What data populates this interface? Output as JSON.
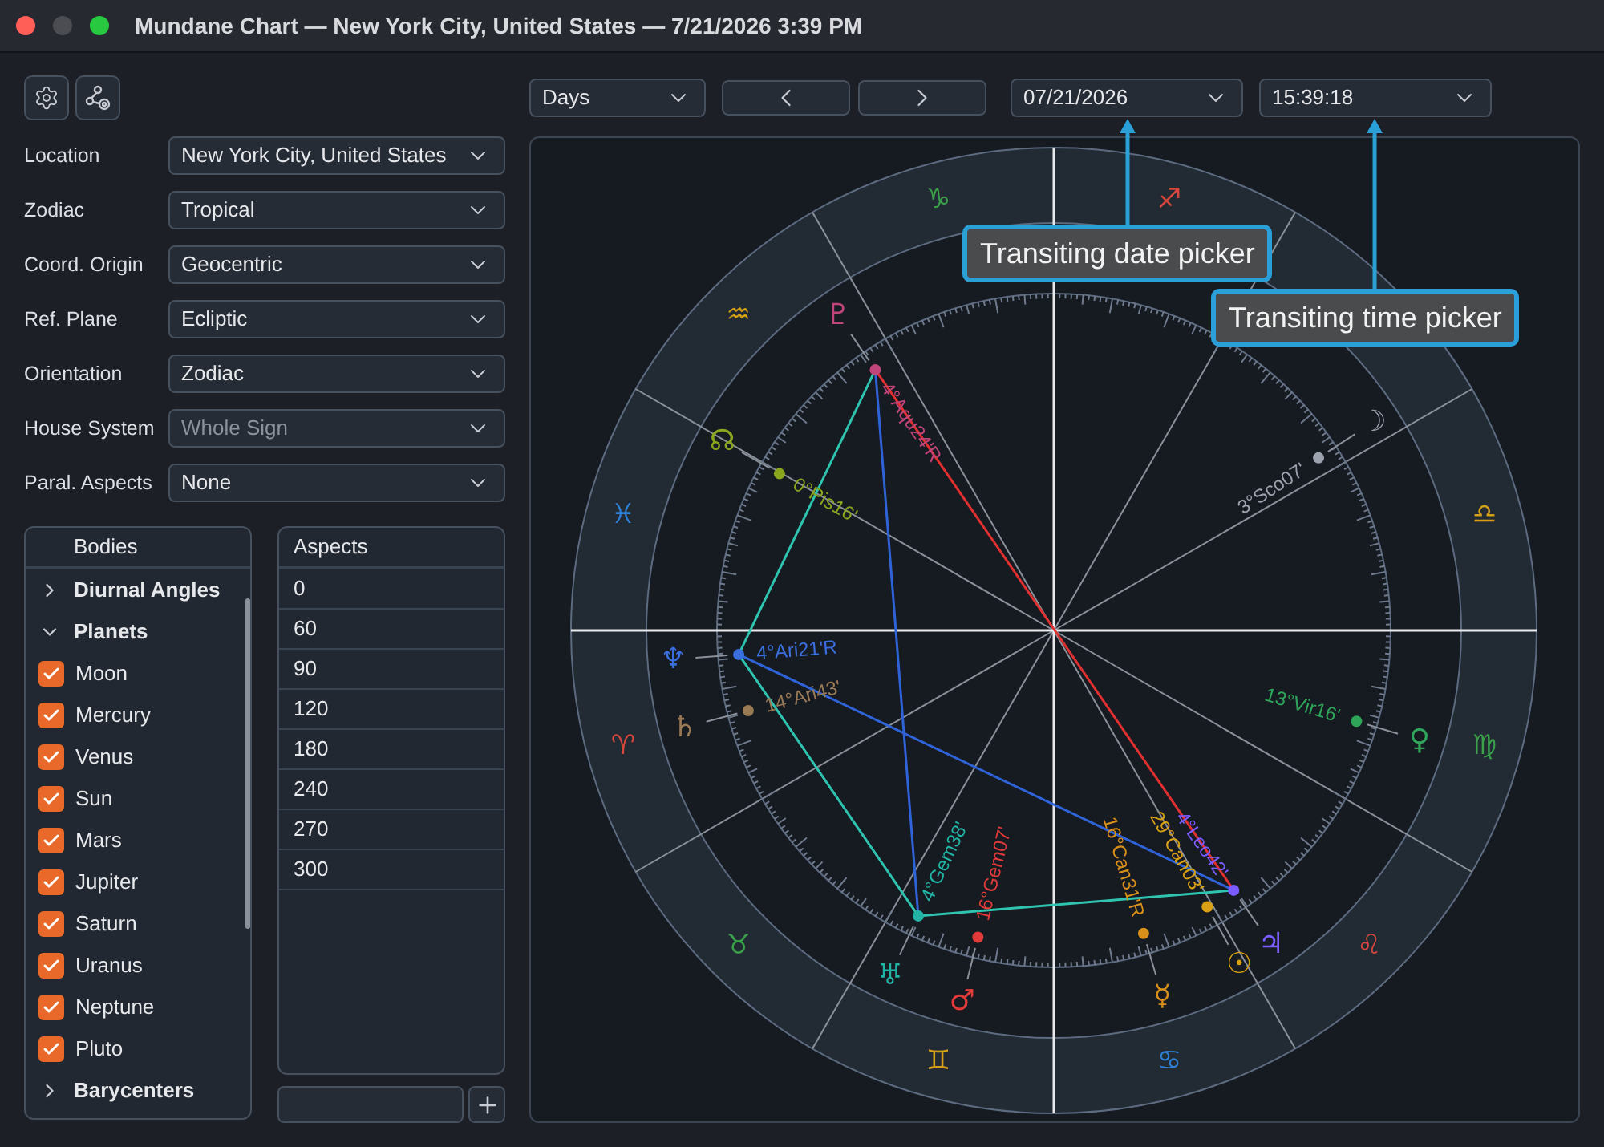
{
  "window": {
    "title": "Mundane Chart — New York City, United States — 7/21/2026 3:39 PM"
  },
  "toolbar": {
    "period": "Days",
    "date": "07/21/2026",
    "time": "15:39:18"
  },
  "callouts": [
    {
      "text": "Transiting date picker"
    },
    {
      "text": "Transiting time picker"
    }
  ],
  "settings": [
    {
      "label": "Location",
      "value": "New York City, United States",
      "disabled": false
    },
    {
      "label": "Zodiac",
      "value": "Tropical",
      "disabled": false
    },
    {
      "label": "Coord. Origin",
      "value": "Geocentric",
      "disabled": false
    },
    {
      "label": "Ref. Plane",
      "value": "Ecliptic",
      "disabled": false
    },
    {
      "label": "Orientation",
      "value": "Zodiac",
      "disabled": false
    },
    {
      "label": "House System",
      "value": "Whole Sign",
      "disabled": true
    },
    {
      "label": "Paral. Aspects",
      "value": "None",
      "disabled": false
    }
  ],
  "bodies": {
    "title": "Bodies",
    "groups": [
      {
        "label": "Diurnal Angles",
        "expanded": false
      },
      {
        "label": "Planets",
        "expanded": true,
        "children": [
          {
            "label": "Moon",
            "checked": true
          },
          {
            "label": "Mercury",
            "checked": true
          },
          {
            "label": "Venus",
            "checked": true
          },
          {
            "label": "Sun",
            "checked": true
          },
          {
            "label": "Mars",
            "checked": true
          },
          {
            "label": "Jupiter",
            "checked": true
          },
          {
            "label": "Saturn",
            "checked": true
          },
          {
            "label": "Uranus",
            "checked": true
          },
          {
            "label": "Neptune",
            "checked": true
          },
          {
            "label": "Pluto",
            "checked": true
          }
        ]
      },
      {
        "label": "Barycenters",
        "expanded": false
      }
    ]
  },
  "aspects": {
    "title": "Aspects",
    "items": [
      "0",
      "60",
      "90",
      "120",
      "180",
      "240",
      "270",
      "300"
    ]
  },
  "chart": {
    "signs": [
      {
        "glyph": "♈",
        "color": "#d9463b"
      },
      {
        "glyph": "♉",
        "color": "#3aa04a"
      },
      {
        "glyph": "♊",
        "color": "#d4a017"
      },
      {
        "glyph": "♋",
        "color": "#2e7fd6"
      },
      {
        "glyph": "♌",
        "color": "#d9463b"
      },
      {
        "glyph": "♍",
        "color": "#3aa04a"
      },
      {
        "glyph": "♎",
        "color": "#d4a017"
      },
      {
        "glyph": "♐",
        "color": "#d9463b"
      },
      {
        "glyph": "♑",
        "color": "#3aa04a"
      },
      {
        "glyph": "♒",
        "color": "#d4a017"
      },
      {
        "glyph": "♓",
        "color": "#2e7fd6"
      }
    ],
    "planets": [
      {
        "glyph": "☽",
        "label": "3°Sco07'",
        "color": "#9ca3af"
      },
      {
        "glyph": "☿",
        "label": "16°Can31'R",
        "color": "#d9901a"
      },
      {
        "glyph": "♀",
        "label": "13°Vir16'",
        "color": "#2fa55a"
      },
      {
        "glyph": "☉",
        "label": "29°Can03'",
        "color": "#d9a015"
      },
      {
        "glyph": "♂",
        "label": "16°Gem07'",
        "color": "#e03a3a"
      },
      {
        "glyph": "♃",
        "label": "4°Leo42'",
        "color": "#7b5cff"
      },
      {
        "glyph": "♄",
        "label": "14°Ari43'",
        "color": "#9a7a55"
      },
      {
        "glyph": "♅",
        "label": "4°Gem38'",
        "color": "#22b5a5"
      },
      {
        "glyph": "♆",
        "label": "4°Ari21'R",
        "color": "#3b6fe0"
      },
      {
        "glyph": "♇",
        "label": "4°Aqu24'R",
        "color": "#c0457a"
      },
      {
        "glyph": "☊",
        "label": "0°Pis16'",
        "color": "#8aa61e"
      }
    ]
  }
}
